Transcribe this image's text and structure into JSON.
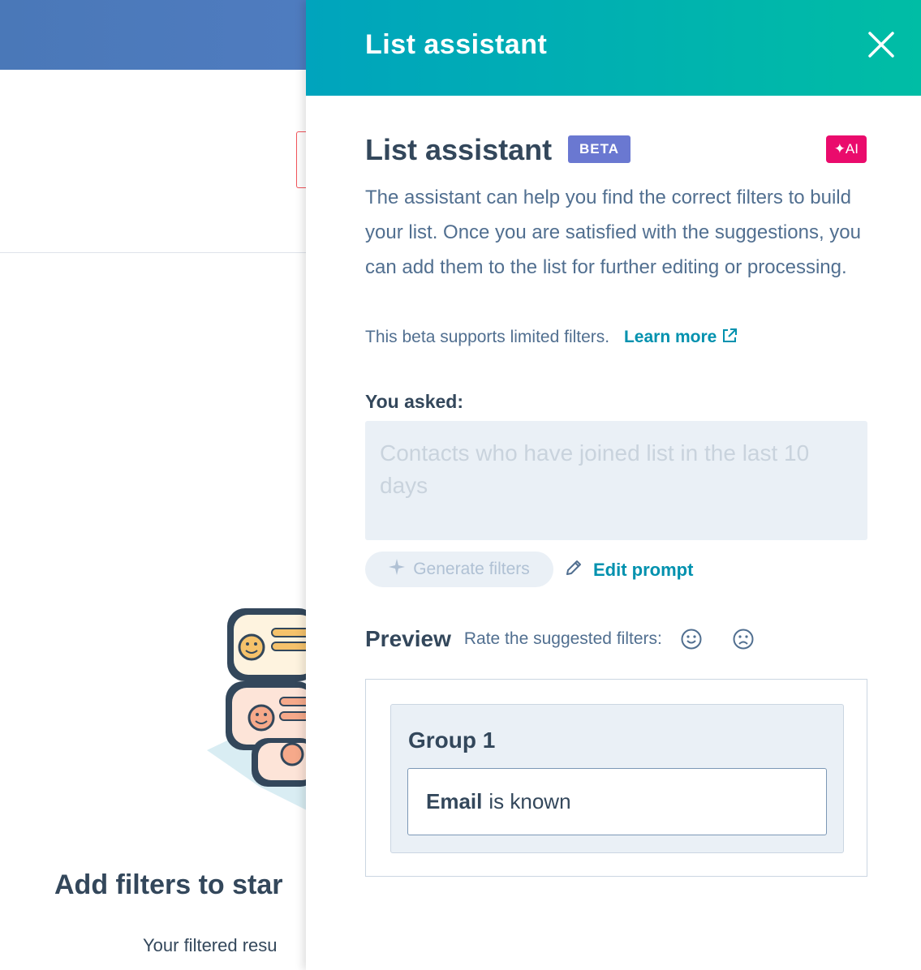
{
  "background": {
    "empty_title": "Add filters to star",
    "empty_subtitle": "Your filtered resu"
  },
  "panel": {
    "header_title": "List assistant",
    "close_icon": "close-icon",
    "title": "List assistant",
    "beta_badge": "BETA",
    "ai_badge": "✦AI",
    "description": "The assistant can help you find the correct filters to build your list. Once you are satisfied with the suggestions, you can add them to the list for further editing or processing.",
    "beta_note": "This beta supports limited filters.",
    "learn_more": "Learn more",
    "you_asked_label": "You asked:",
    "prompt_text": "Contacts who have joined list in the last 10 days",
    "generate_button": "Generate filters",
    "edit_prompt": "Edit prompt",
    "preview_title": "Preview",
    "rate_label": "Rate the suggested filters:",
    "group_title": "Group 1",
    "filter_property": "Email",
    "filter_condition": "is known"
  },
  "colors": {
    "header_gradient_start": "#00a4bd",
    "header_gradient_end": "#00bda5",
    "beta_badge": "#6a78d1",
    "ai_badge": "#ea0b6c",
    "link": "#0091ae",
    "side_tab": "#ffbc2b"
  }
}
